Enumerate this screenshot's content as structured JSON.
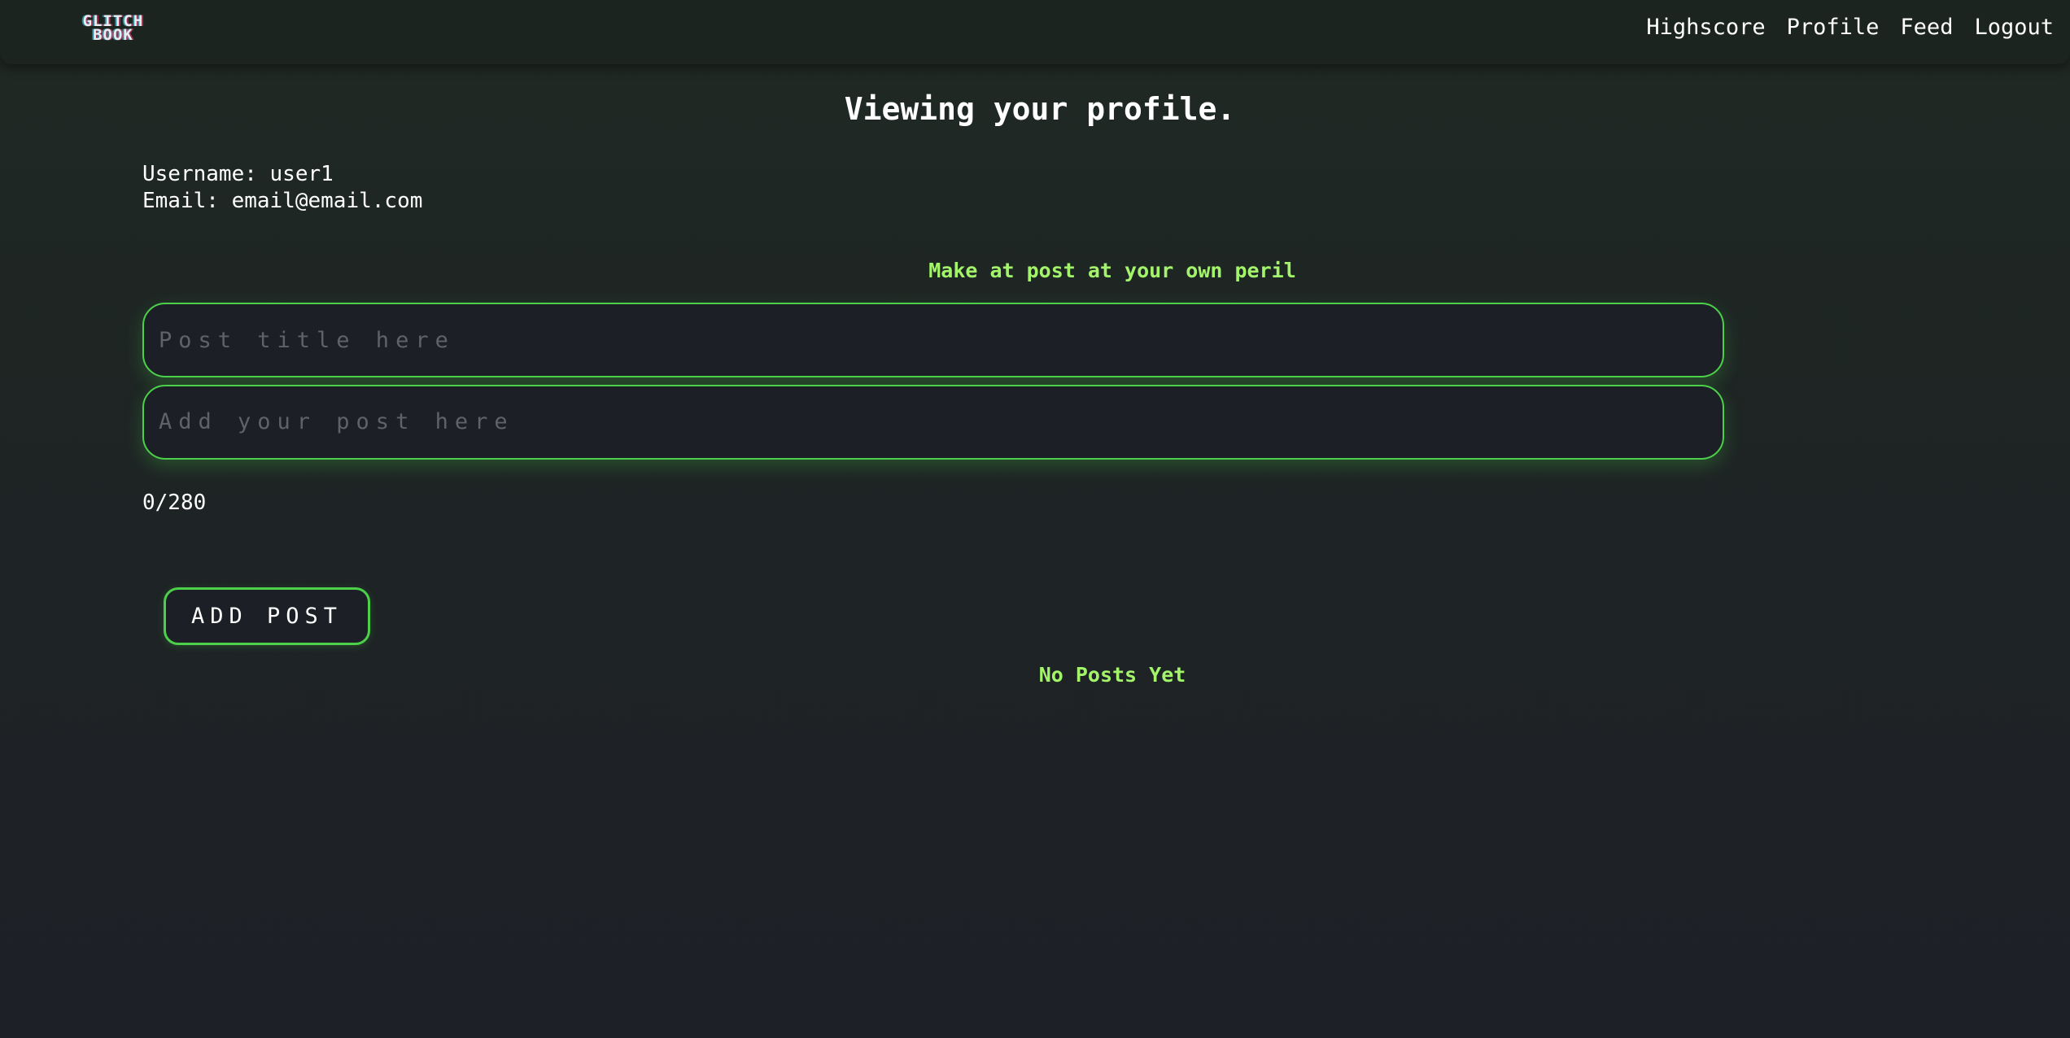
{
  "navbar": {
    "logo_line1": "GLITCH",
    "logo_line2": "BOOK",
    "links": [
      {
        "label": "Highscore"
      },
      {
        "label": "Profile"
      },
      {
        "label": "Feed"
      },
      {
        "label": "Logout"
      }
    ]
  },
  "page": {
    "title": "Viewing your profile."
  },
  "profile": {
    "username_line": "Username: user1",
    "email_line": "Email: email@email.com"
  },
  "post_form": {
    "prompt": "Make at post at your own peril",
    "title_placeholder": "Post title here",
    "title_value": "",
    "body_placeholder": "Add your post here",
    "body_value": "",
    "char_count": "0/280",
    "submit_label": "ADD POST"
  },
  "posts": {
    "empty_message": "No Posts Yet"
  },
  "colors": {
    "accent_green": "#4cd04a",
    "highlight_text": "#a3f46a",
    "background": "#1e2325"
  }
}
